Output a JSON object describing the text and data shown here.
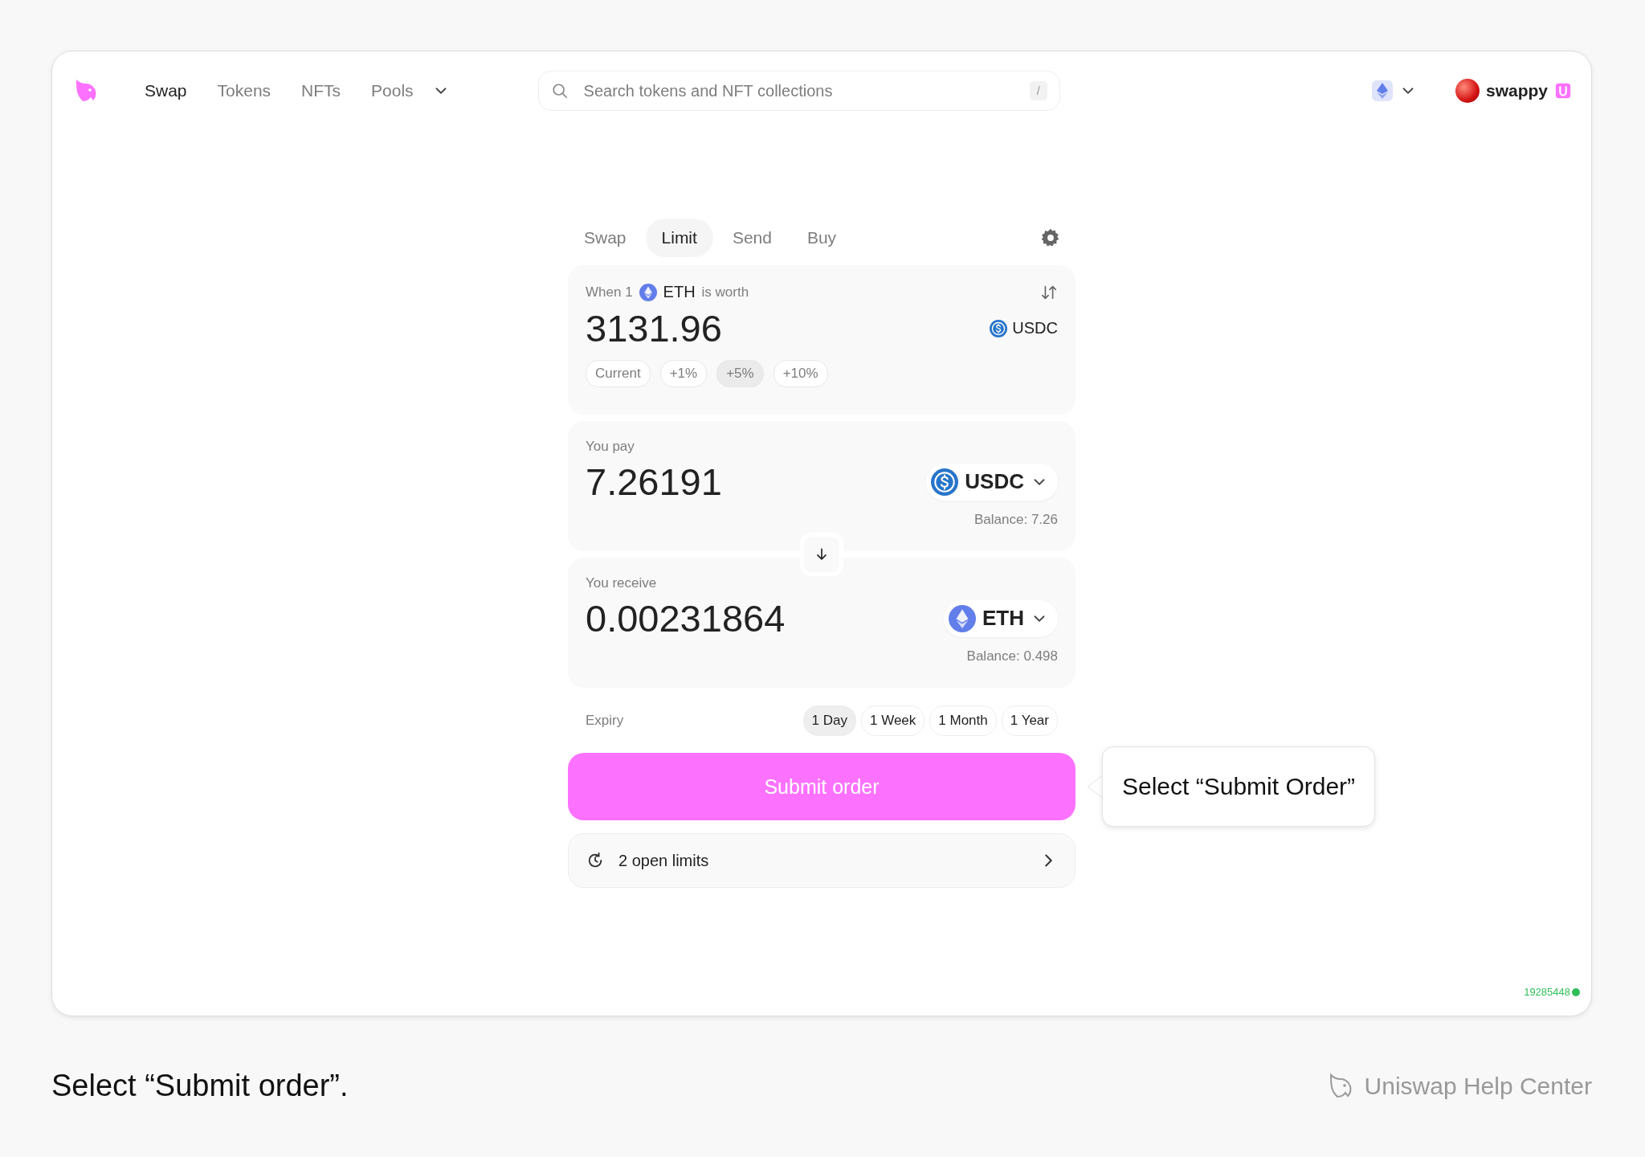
{
  "nav": {
    "items": [
      {
        "label": "Swap",
        "selected": true
      },
      {
        "label": "Tokens",
        "selected": false
      },
      {
        "label": "NFTs",
        "selected": false
      },
      {
        "label": "Pools",
        "selected": false
      }
    ]
  },
  "search": {
    "placeholder": "Search tokens and NFT collections",
    "shortcut": "/"
  },
  "account": {
    "name": "swappy"
  },
  "widget": {
    "tabs": [
      {
        "label": "Swap",
        "selected": false
      },
      {
        "label": "Limit",
        "selected": true
      },
      {
        "label": "Send",
        "selected": false
      },
      {
        "label": "Buy",
        "selected": false
      }
    ],
    "rate": {
      "prefix": "When 1",
      "token": {
        "kind": "eth",
        "symbol": "ETH"
      },
      "suffix": "is worth",
      "value": "3131.96",
      "quote": {
        "kind": "usdc",
        "symbol": "USDC"
      },
      "presets": [
        {
          "label": "Current",
          "selected": false
        },
        {
          "label": "+1%",
          "selected": false
        },
        {
          "label": "+5%",
          "selected": true
        },
        {
          "label": "+10%",
          "selected": false
        }
      ]
    },
    "pay": {
      "label": "You pay",
      "amount": "7.26191",
      "token": {
        "kind": "usdc",
        "symbol": "USDC"
      },
      "balance": "Balance: 7.26"
    },
    "receive": {
      "label": "You receive",
      "amount": "0.00231864",
      "token": {
        "kind": "eth",
        "symbol": "ETH"
      },
      "balance": "Balance: 0.498"
    },
    "expiry": {
      "label": "Expiry",
      "options": [
        {
          "label": "1 Day",
          "selected": true
        },
        {
          "label": "1 Week",
          "selected": false
        },
        {
          "label": "1 Month",
          "selected": false
        },
        {
          "label": "1 Year",
          "selected": false
        }
      ]
    },
    "submit": "Submit order",
    "open_limits": "2 open limits"
  },
  "callout": "Select “Submit Order”",
  "block_number": "19285448",
  "caption": "Select “Submit order”.",
  "brand": "Uniswap Help Center"
}
